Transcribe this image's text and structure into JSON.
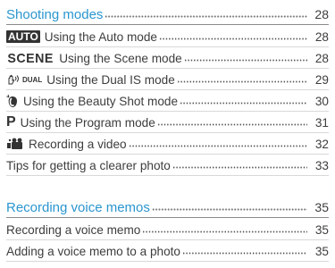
{
  "sections": [
    {
      "title": "Shooting modes",
      "page": "28",
      "items": [
        {
          "icon": "auto-mode-icon",
          "badge": "AUTO",
          "label": "Using the Auto mode",
          "page": "28"
        },
        {
          "icon": "scene-mode-icon",
          "badge": "SCENE",
          "label": "Using the Scene mode",
          "page": "28"
        },
        {
          "icon": "dual-is-icon",
          "badge": "DUAL",
          "label": "Using the Dual IS mode",
          "page": "29"
        },
        {
          "icon": "beauty-shot-icon",
          "label": "Using the Beauty Shot mode",
          "page": "30"
        },
        {
          "icon": "program-mode-icon",
          "badge": "P",
          "label": "Using the Program mode",
          "page": "31"
        },
        {
          "icon": "video-camera-icon",
          "label": "Recording a video",
          "page": "32"
        },
        {
          "icon": null,
          "label": "Tips for getting a clearer photo",
          "page": "33"
        }
      ]
    },
    {
      "title": "Recording voice memos",
      "page": "35",
      "items": [
        {
          "icon": null,
          "label": "Recording a voice memo",
          "page": "35"
        },
        {
          "icon": null,
          "label": "Adding a voice memo to a photo",
          "page": "35"
        }
      ]
    }
  ],
  "colors": {
    "heading": "#2a96cf",
    "text": "#3d3d3d"
  }
}
